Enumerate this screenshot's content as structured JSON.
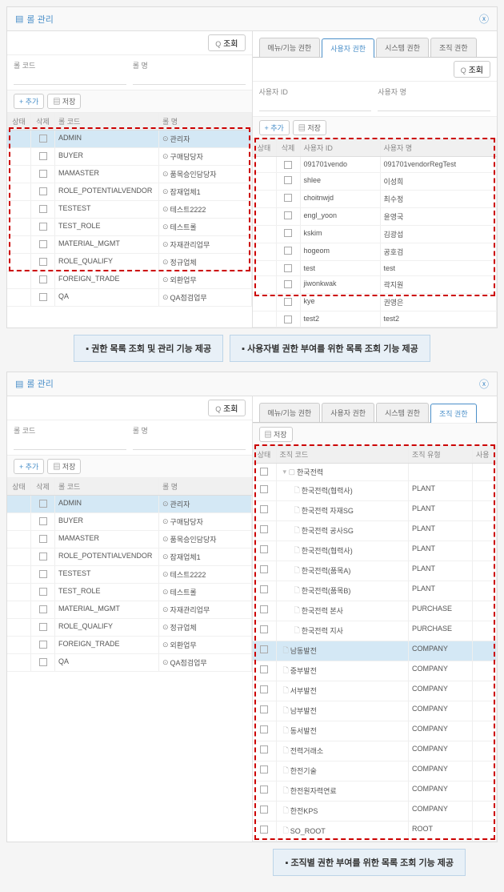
{
  "panel1": {
    "title": "롤 관리",
    "search_label": "조회",
    "filter_code_label": "롤 코드",
    "filter_name_label": "롤 명",
    "add_btn": "+ 추가",
    "save_btn": "저장",
    "grid_headers": {
      "state": "상태",
      "del": "삭제",
      "code": "롤 코드",
      "name": "롤 명"
    },
    "roles": [
      {
        "code": "ADMIN",
        "name": "관리자",
        "selected": true
      },
      {
        "code": "BUYER",
        "name": "구매담당자"
      },
      {
        "code": "MAMASTER",
        "name": "품목승인담당자"
      },
      {
        "code": "ROLE_POTENTIALVENDOR",
        "name": "잠재업체1"
      },
      {
        "code": "TESTEST",
        "name": "테스트2222"
      },
      {
        "code": "TEST_ROLE",
        "name": "테스트롤"
      },
      {
        "code": "MATERIAL_MGMT",
        "name": "자재관리업무"
      },
      {
        "code": "ROLE_QUALIFY",
        "name": "정규업체"
      },
      {
        "code": "FOREIGN_TRADE",
        "name": "외환업무"
      },
      {
        "code": "QA",
        "name": "QA점검업무"
      }
    ],
    "tabs": {
      "t1": "메뉴/기능 권한",
      "t2": "사용자 권한",
      "t3": "시스템 권한",
      "t4": "조직 권한"
    },
    "user_filter_id": "사용자 ID",
    "user_filter_name": "사용자 명",
    "user_headers": {
      "state": "상태",
      "del": "삭제",
      "uid": "사용자 ID",
      "uname": "사용자 명"
    },
    "users": [
      {
        "uid": "091701vendo",
        "uname": "091701vendorRegTest"
      },
      {
        "uid": "shlee",
        "uname": "이성희"
      },
      {
        "uid": "choitnwjd",
        "uname": "최수정"
      },
      {
        "uid": "engl_yoon",
        "uname": "윤영국"
      },
      {
        "uid": "kskim",
        "uname": "김광섭"
      },
      {
        "uid": "hogeom",
        "uname": "공호검"
      },
      {
        "uid": "test",
        "uname": "test"
      },
      {
        "uid": "jiwonkwak",
        "uname": "곽지원"
      },
      {
        "uid": "kye",
        "uname": "권영은"
      },
      {
        "uid": "test2",
        "uname": "test2"
      }
    ]
  },
  "callouts": {
    "c1": "▪ 권한 목록 조회 및 관리 기능 제공",
    "c2": "▪ 사용자별 권한 부여를 위한 목록 조회 기능 제공",
    "c3": "▪ 조직별 권한 부여를 위한 목록 조회 기능 제공"
  },
  "panel2": {
    "org_headers": {
      "state": "상태",
      "code": "조직 코드",
      "type": "조직 유형",
      "use": "사용"
    },
    "tree": [
      {
        "name": "한국전력",
        "type": "",
        "indent": 0,
        "folder": true
      },
      {
        "name": "한국전력(협력사)",
        "type": "PLANT",
        "indent": 1
      },
      {
        "name": "한국전력 자재SG",
        "type": "PLANT",
        "indent": 1
      },
      {
        "name": "한국전력 공사SG",
        "type": "PLANT",
        "indent": 1
      },
      {
        "name": "한국전력(협력사)",
        "type": "PLANT",
        "indent": 1
      },
      {
        "name": "한국전력(품목A)",
        "type": "PLANT",
        "indent": 1
      },
      {
        "name": "한국전력(품목B)",
        "type": "PLANT",
        "indent": 1
      },
      {
        "name": "한국전력 본사",
        "type": "PURCHASE",
        "indent": 1
      },
      {
        "name": "한국전력 지사",
        "type": "PURCHASE",
        "indent": 1
      },
      {
        "name": "남동발전",
        "type": "COMPANY",
        "indent": 0,
        "hl": true
      },
      {
        "name": "중부발전",
        "type": "COMPANY",
        "indent": 0
      },
      {
        "name": "서부발전",
        "type": "COMPANY",
        "indent": 0
      },
      {
        "name": "남부발전",
        "type": "COMPANY",
        "indent": 0
      },
      {
        "name": "동서발전",
        "type": "COMPANY",
        "indent": 0
      },
      {
        "name": "전력거래소",
        "type": "COMPANY",
        "indent": 0
      },
      {
        "name": "한전기술",
        "type": "COMPANY",
        "indent": 0
      },
      {
        "name": "한전원자력연료",
        "type": "COMPANY",
        "indent": 0
      },
      {
        "name": "한전KPS",
        "type": "COMPANY",
        "indent": 0
      },
      {
        "name": "SO_ROOT",
        "type": "ROOT",
        "indent": 0
      }
    ]
  }
}
